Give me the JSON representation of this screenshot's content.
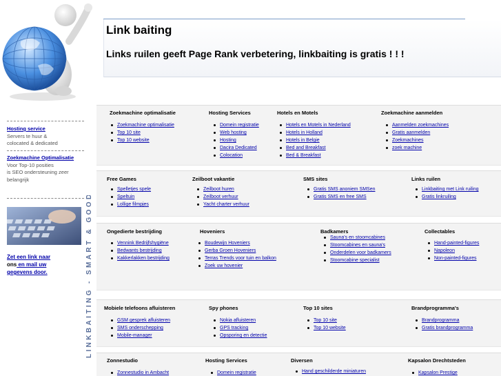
{
  "header": {
    "title": "Link baiting",
    "subtitle": "Links ruilen geeft Page Rank verbetering, linkbaiting is gratis ! ! !"
  },
  "left": {
    "hosting_link": "Hosting service",
    "hosting_text": [
      "Servers te huur &",
      "colocated & dedicated"
    ],
    "seo_link": "Zoekmachine Optimalisatie",
    "seo_text": [
      "Voor Top-10 posities",
      "is SEO ondersteuning zeer",
      "belangrijk"
    ],
    "linkto_link": "Zet een link naar",
    "linkto_mid": "ons",
    "linkto_link2": " en mail uw",
    "linkto_link3": "gegevens door."
  },
  "brand_vertical": "LINKBAITING - SMART & GOOD",
  "sections": [
    {
      "columns": [
        {
          "title": "Zoekmachine optimalisatie",
          "links": [
            "Zoekmachine optimalisatie",
            "Top 10 site",
            "Top 10 website"
          ]
        },
        {
          "title": "Hosting Services",
          "links": [
            "Domein registratie",
            "Web hosting",
            "Hosting",
            "Dacira Dedicated",
            "Colocation"
          ]
        },
        {
          "title": "Hotels en Motels",
          "links": [
            "Hotels en Motels in Nederland",
            "Hotels in Holland",
            "Hotels in Belgie",
            "Bed and Breakfast",
            "Bed & Breakfast"
          ]
        },
        {
          "title": "Zoekmachine aanmelden",
          "links": [
            "Aanmelden zoekmachines",
            "Gratis aanmelden",
            "Zoekmachines",
            "zoek machine "
          ]
        }
      ]
    },
    {
      "columns": [
        {
          "title": "Free Games",
          "links": [
            "Spelletjes spele",
            "Speltuin",
            "Lollige filmpjes"
          ]
        },
        {
          "title": "Zeilboot vakantie",
          "links": [
            "Zeilboot huren",
            "Zeilboot verhuur",
            "Yacht charter verhuur"
          ]
        },
        {
          "title": "SMS sites",
          "links": [
            "Gratis SMS anoniem SMSen",
            "Gratis SMS en free SMS"
          ]
        },
        {
          "title": "Links ruilen",
          "links": [
            "Linkbaiting met Link ruiling",
            "Gratis linkruiling"
          ]
        }
      ]
    },
    {
      "columns": [
        {
          "title": "Ongedierte bestrijding",
          "links": [
            "Vennink Bedrijfshygiëne",
            "Bedwants bestrijding",
            "Kakkerlakken bestrijding"
          ]
        },
        {
          "title": "Hoveniers",
          "links": [
            "Boudewijn Hoveniers",
            "Gerba Groen Hoveniers",
            "Terras Trends voor tuin en balkon",
            "Zoek uw hovenier"
          ]
        },
        {
          "title": "Badkamers",
          "links": [
            "Sauna's en stoomcabines",
            "Stoomcabines en sauna's",
            "Onderdelen voor badkamers",
            "Stoomcabine specialist"
          ]
        },
        {
          "title": "Collectables",
          "links": [
            "Hand-painted-figures",
            "Napoleon",
            "Non-painted-figures"
          ]
        }
      ]
    },
    {
      "columns": [
        {
          "title": "Mobiele telefoons afluisteren",
          "links": [
            "GSM gesprek afluisteren",
            "SMS onderschepping",
            "Mobile-manager"
          ]
        },
        {
          "title": "Spy phones",
          "links": [
            "Nokia afluisteren",
            "GPS tracking",
            "Opsporing en detectie"
          ]
        },
        {
          "title": "Top 10 sites",
          "links": [
            "Top 10 site",
            "Top 10 website"
          ]
        },
        {
          "title": "Brandprogramma's",
          "links": [
            "Brandprogramma",
            "Gratis brandprogramma"
          ]
        }
      ]
    },
    {
      "columns": [
        {
          "title": "Zonnestudio",
          "links": [
            "Zonnestudio in Ambacht"
          ]
        },
        {
          "title": "Hosting Services",
          "links": [
            "Domein registratie"
          ]
        },
        {
          "title": "Diversen",
          "links": [
            "Hand geschilderde miniaturen"
          ]
        },
        {
          "title": "Kapsalon Drechtsteden",
          "links": [
            "Kapsalon Prestige"
          ]
        }
      ]
    }
  ]
}
